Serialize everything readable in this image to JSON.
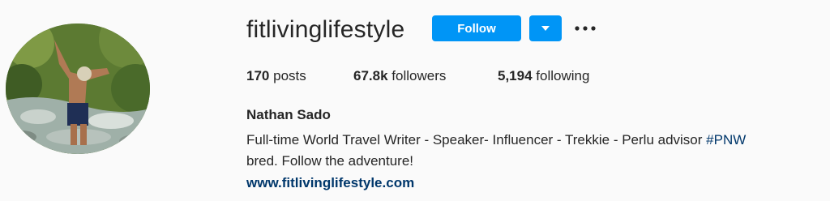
{
  "profile": {
    "username": "fitlivinglifestyle",
    "avatar_alt": "profile-photo",
    "follow_label": "Follow",
    "dropdown_icon": "caret-down-icon",
    "more_icon": "more-options-icon",
    "stats": {
      "posts_count": "170",
      "posts_label": "posts",
      "followers_count": "67.8k",
      "followers_label": "followers",
      "following_count": "5,194",
      "following_label": "following"
    },
    "full_name": "Nathan Sado",
    "bio_line1": "Full-time World Travel Writer - Speaker- Influencer - Trekkie - Perlu advisor ",
    "bio_hashtag": "#PNW",
    "bio_line2": "bred. Follow the adventure!",
    "website": "www.fitlivinglifestyle.com"
  },
  "colors": {
    "background": "#fafafa",
    "button_blue": "#0095f6",
    "link_blue": "#00376b",
    "text": "#262626"
  }
}
